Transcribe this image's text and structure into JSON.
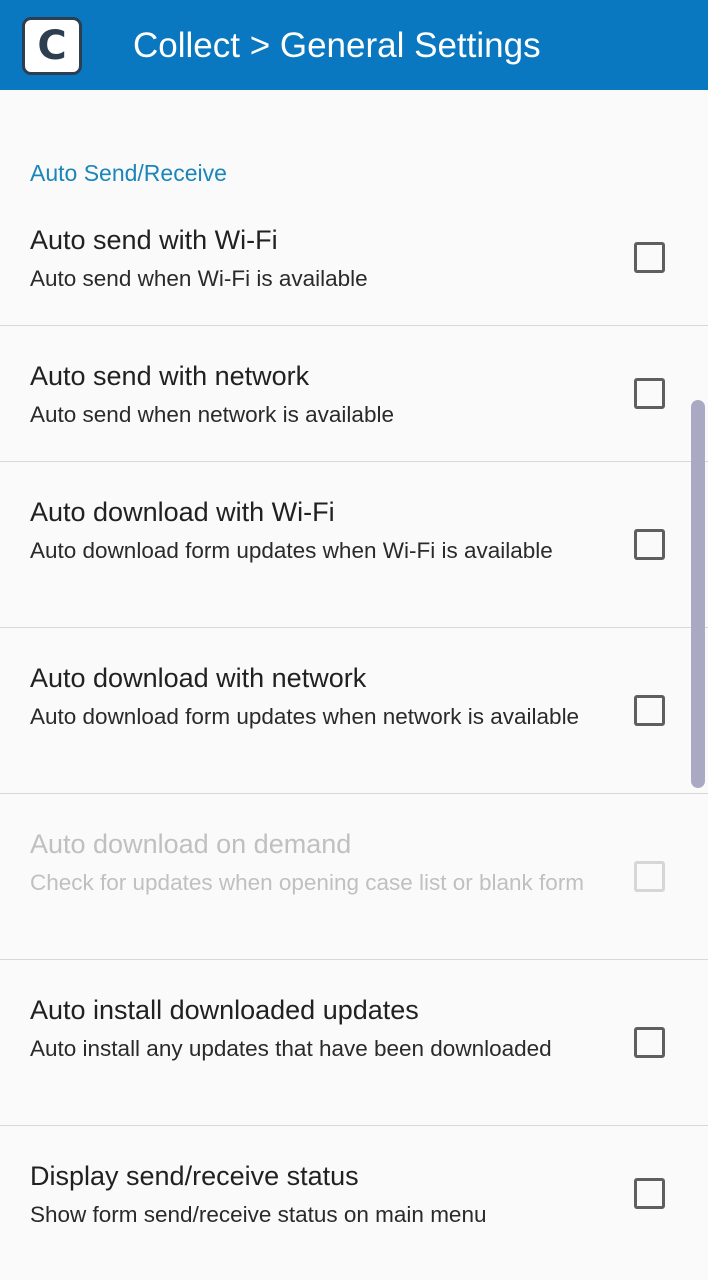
{
  "appbar": {
    "logo_letter": "C",
    "title": "Collect > General Settings"
  },
  "section": {
    "header": "Auto Send/Receive"
  },
  "preferences": [
    {
      "title": "Auto send with Wi-Fi",
      "summary": "Auto send when Wi-Fi is available",
      "checked": false,
      "enabled": true
    },
    {
      "title": "Auto send with network",
      "summary": "Auto send when network is available",
      "checked": false,
      "enabled": true
    },
    {
      "title": "Auto download with Wi-Fi",
      "summary": "Auto download form updates when Wi-Fi is available",
      "checked": false,
      "enabled": true
    },
    {
      "title": "Auto download with network",
      "summary": "Auto download form updates when network is available",
      "checked": false,
      "enabled": true
    },
    {
      "title": "Auto download on demand",
      "summary": "Check for updates when opening case list or blank form",
      "checked": false,
      "enabled": false
    },
    {
      "title": "Auto install downloaded updates",
      "summary": "Auto install any updates that have been downloaded",
      "checked": false,
      "enabled": true
    },
    {
      "title": "Display send/receive status",
      "summary": "Show form send/receive status on main menu",
      "checked": false,
      "enabled": true
    }
  ]
}
